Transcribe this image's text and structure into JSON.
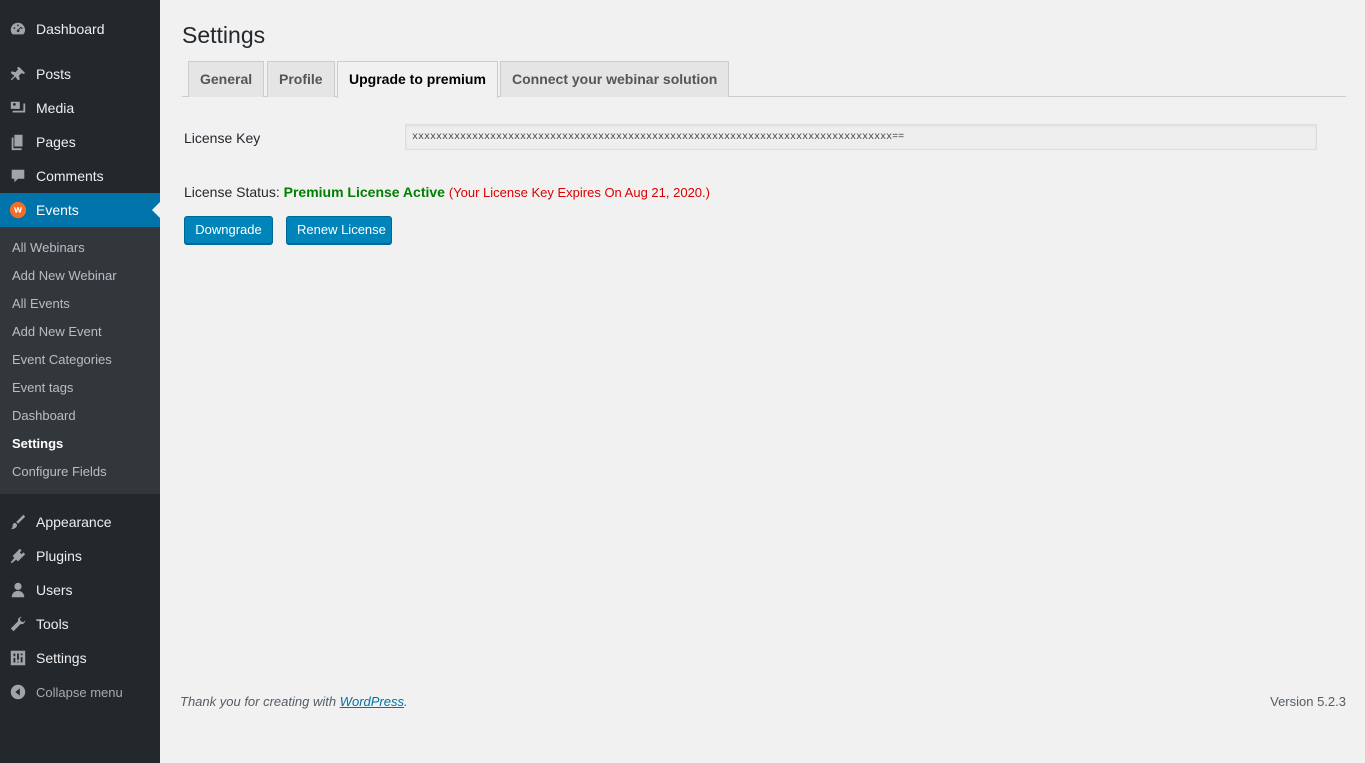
{
  "sidebar": {
    "top_items": [
      {
        "label": "Dashboard",
        "icon": "dashboard-icon"
      },
      {
        "label": "Posts",
        "icon": "pin-icon"
      },
      {
        "label": "Media",
        "icon": "media-icon"
      },
      {
        "label": "Pages",
        "icon": "pages-icon"
      },
      {
        "label": "Comments",
        "icon": "comment-icon"
      }
    ],
    "active_item": {
      "label": "Events",
      "icon": "events-logo-icon"
    },
    "submenu": [
      "All Webinars",
      "Add New Webinar",
      "All Events",
      "Add New Event",
      "Event Categories",
      "Event tags",
      "Dashboard",
      "Settings",
      "Configure Fields"
    ],
    "bottom_items": [
      {
        "label": "Appearance",
        "icon": "brush-icon"
      },
      {
        "label": "Plugins",
        "icon": "plugin-icon"
      },
      {
        "label": "Users",
        "icon": "user-icon"
      },
      {
        "label": "Tools",
        "icon": "wrench-icon"
      },
      {
        "label": "Settings",
        "icon": "settings-icon"
      }
    ],
    "collapse_label": "Collapse menu"
  },
  "page": {
    "title": "Settings",
    "tabs": [
      "General",
      "Profile",
      "Upgrade to premium",
      "Connect your webinar solution"
    ],
    "active_tab": "Upgrade to premium"
  },
  "license": {
    "key_label": "License Key",
    "key_value": "xxxxxxxxxxxxxxxxxxxxxxxxxxxxxxxxxxxxxxxxxxxxxxxxxxxxxxxxxxxxxxxxxxxxxxxxxxxxxxxx==",
    "status_label": "License Status:",
    "status_value": "Premium License Active",
    "expiry_text": "(Your License Key Expires On Aug 21, 2020.)",
    "downgrade_label": "Downgrade",
    "renew_label": "Renew License"
  },
  "footer": {
    "thanks_prefix": "Thank you for creating with ",
    "thanks_link": "WordPress",
    "thanks_suffix": ".",
    "version": "Version 5.2.3"
  },
  "colors": {
    "sidebar_bg": "#23282d",
    "submenu_bg": "#32373c",
    "active_bg": "#0073aa",
    "button_bg": "#0085ba",
    "status_active": "#008000",
    "status_expiry": "#dd0000"
  }
}
